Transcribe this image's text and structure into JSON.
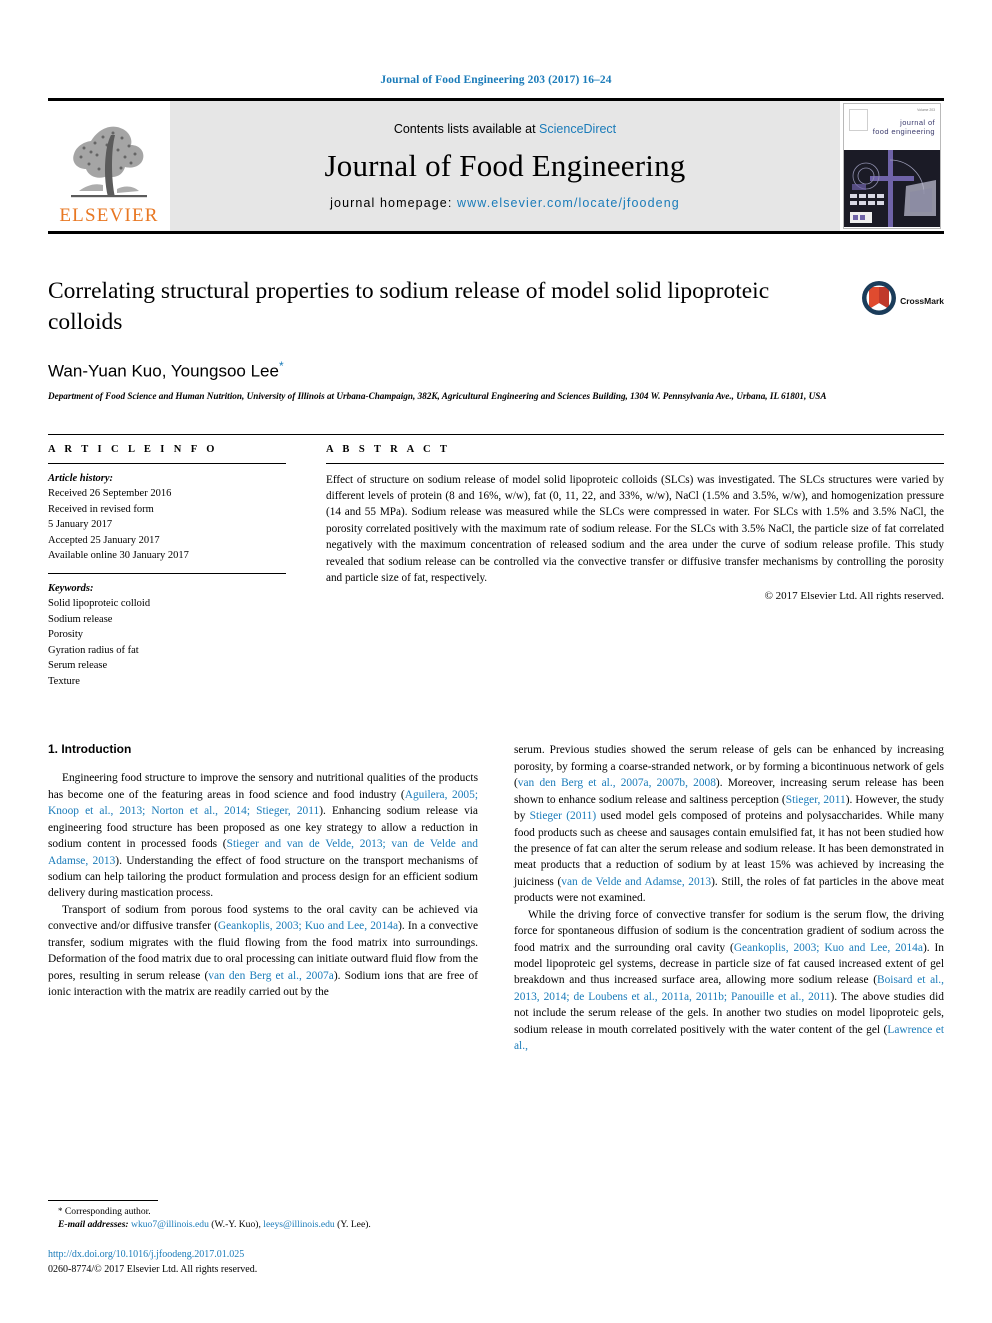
{
  "running_head": "Journal of Food Engineering 203 (2017) 16–24",
  "masthead": {
    "contents_prefix": "Contents lists available at ",
    "sciencedirect": "ScienceDirect",
    "journal_title": "Journal of Food Engineering",
    "homepage_prefix": "journal homepage: ",
    "homepage_url": "www.elsevier.com/locate/jfoodeng",
    "publisher_wordmark": "ELSEVIER",
    "cover": {
      "title_line1": "journal of",
      "title_line2": "food engineering",
      "issue_note": "Volume 203"
    },
    "accent_blue": "#1a7bb9",
    "elsevier_orange": "#e87722",
    "band_gray": "#e6e6e6"
  },
  "article": {
    "title": "Correlating structural properties to sodium release of model solid lipoproteic colloids",
    "authors": "Wan-Yuan Kuo, Youngsoo Lee",
    "corresponding_marker": "*",
    "affiliation": "Department of Food Science and Human Nutrition, University of Illinois at Urbana-Champaign, 382K, Agricultural Engineering and Sciences Building, 1304 W. Pennsylvania Ave., Urbana, IL 61801, USA",
    "crossmark_label": "CrossMark"
  },
  "article_info": {
    "heading": "A R T I C L E   I N F O",
    "history_head": "Article history:",
    "history_lines": [
      "Received 26 September 2016",
      "Received in revised form",
      "5 January 2017",
      "Accepted 25 January 2017",
      "Available online 30 January 2017"
    ],
    "keywords_head": "Keywords:",
    "keywords": [
      "Solid lipoproteic colloid",
      "Sodium release",
      "Porosity",
      "Gyration radius of fat",
      "Serum release",
      "Texture"
    ]
  },
  "abstract": {
    "heading": "A B S T R A C T",
    "text": "Effect of structure on sodium release of model solid lipoproteic colloids (SLCs) was investigated. The SLCs structures were varied by different levels of protein (8 and 16%, w/w), fat (0, 11, 22, and 33%, w/w), NaCl (1.5% and 3.5%, w/w), and homogenization pressure (14 and 55 MPa). Sodium release was measured while the SLCs were compressed in water. For SLCs with 1.5% and 3.5% NaCl, the porosity correlated positively with the maximum rate of sodium release. For the SLCs with 3.5% NaCl, the particle size of fat correlated negatively with the maximum concentration of released sodium and the area under the curve of sodium release profile. This study revealed that sodium release can be controlled via the convective transfer or diffusive transfer mechanisms by controlling the porosity and particle size of fat, respectively.",
    "copyright": "© 2017 Elsevier Ltd. All rights reserved."
  },
  "introduction": {
    "heading": "1. Introduction",
    "left_paragraphs": [
      {
        "segments": [
          {
            "t": "Engineering food structure to improve the sensory and nutritional qualities of the products has become one of the featuring areas in food science and food industry (",
            "cite": false
          },
          {
            "t": "Aguilera, 2005; Knoop et al., 2013; Norton et al., 2014; Stieger, 2011",
            "cite": true
          },
          {
            "t": "). Enhancing sodium release via engineering food structure has been proposed as one key strategy to allow a reduction in sodium content in processed foods (",
            "cite": false
          },
          {
            "t": "Stieger and van de Velde, 2013; van de Velde and Adamse, 2013",
            "cite": true
          },
          {
            "t": "). Understanding the effect of food structure on the transport mechanisms of sodium can help tailoring the product formulation and process design for an efficient sodium delivery during mastication process.",
            "cite": false
          }
        ]
      },
      {
        "segments": [
          {
            "t": "Transport of sodium from porous food systems to the oral cavity can be achieved via convective and/or diffusive transfer (",
            "cite": false
          },
          {
            "t": "Geankoplis, 2003; Kuo and Lee, 2014a",
            "cite": true
          },
          {
            "t": "). In a convective transfer, sodium migrates with the fluid flowing from the food matrix into surroundings. Deformation of the food matrix due to oral processing can initiate outward fluid flow from the pores, resulting in serum release (",
            "cite": false
          },
          {
            "t": "van den Berg et al., 2007a",
            "cite": true
          },
          {
            "t": "). Sodium ions that are free of ionic interaction with the matrix are readily carried out by the",
            "cite": false
          }
        ]
      }
    ],
    "right_paragraphs": [
      {
        "segments": [
          {
            "t": "serum. Previous studies showed the serum release of gels can be enhanced by increasing porosity, by forming a coarse-stranded network, or by forming a bicontinuous network of gels (",
            "cite": false
          },
          {
            "t": "van den Berg et al., 2007a, 2007b, 2008",
            "cite": true
          },
          {
            "t": "). Moreover, increasing serum release has been shown to enhance sodium release and saltiness perception (",
            "cite": false
          },
          {
            "t": "Stieger, 2011",
            "cite": true
          },
          {
            "t": "). However, the study by ",
            "cite": false
          },
          {
            "t": "Stieger (2011)",
            "cite": true
          },
          {
            "t": " used model gels composed of proteins and polysaccharides. While many food products such as cheese and sausages contain emulsified fat, it has not been studied how the presence of fat can alter the serum release and sodium release. It has been demonstrated in meat products that a reduction of sodium by at least 15% was achieved by increasing the juiciness (",
            "cite": false
          },
          {
            "t": "van de Velde and Adamse, 2013",
            "cite": true
          },
          {
            "t": "). Still, the roles of fat particles in the above meat products were not examined.",
            "cite": false
          }
        ]
      },
      {
        "segments": [
          {
            "t": "While the driving force of convective transfer for sodium is the serum flow, the driving force for spontaneous diffusion of sodium is the concentration gradient of sodium across the food matrix and the surrounding oral cavity (",
            "cite": false
          },
          {
            "t": "Geankoplis, 2003; Kuo and Lee, 2014a",
            "cite": true
          },
          {
            "t": "). In model lipoproteic gel systems, decrease in particle size of fat caused increased extent of gel breakdown and thus increased surface area, allowing more sodium release (",
            "cite": false
          },
          {
            "t": "Boisard et al., 2013, 2014; de Loubens et al., 2011a, 2011b; Panouille et al., 2011",
            "cite": true
          },
          {
            "t": "). The above studies did not include the serum release of the gels. In another two studies on model lipoproteic gels, sodium release in mouth correlated positively with the water content of the gel (",
            "cite": false
          },
          {
            "t": "Lawrence et al.,",
            "cite": true
          }
        ]
      }
    ]
  },
  "footnotes": {
    "corresponding_marker": "*",
    "corresponding_text": " Corresponding author.",
    "email_label": "E-mail addresses:",
    "emails": [
      {
        "address": "wkuo7@illinois.edu",
        "owner": "(W.-Y. Kuo)"
      },
      {
        "address": "leeys@illinois.edu",
        "owner": "(Y. Lee)"
      }
    ],
    "doi": "http://dx.doi.org/10.1016/j.jfoodeng.2017.01.025",
    "issn_line": "0260-8774/© 2017 Elsevier Ltd. All rights reserved."
  }
}
